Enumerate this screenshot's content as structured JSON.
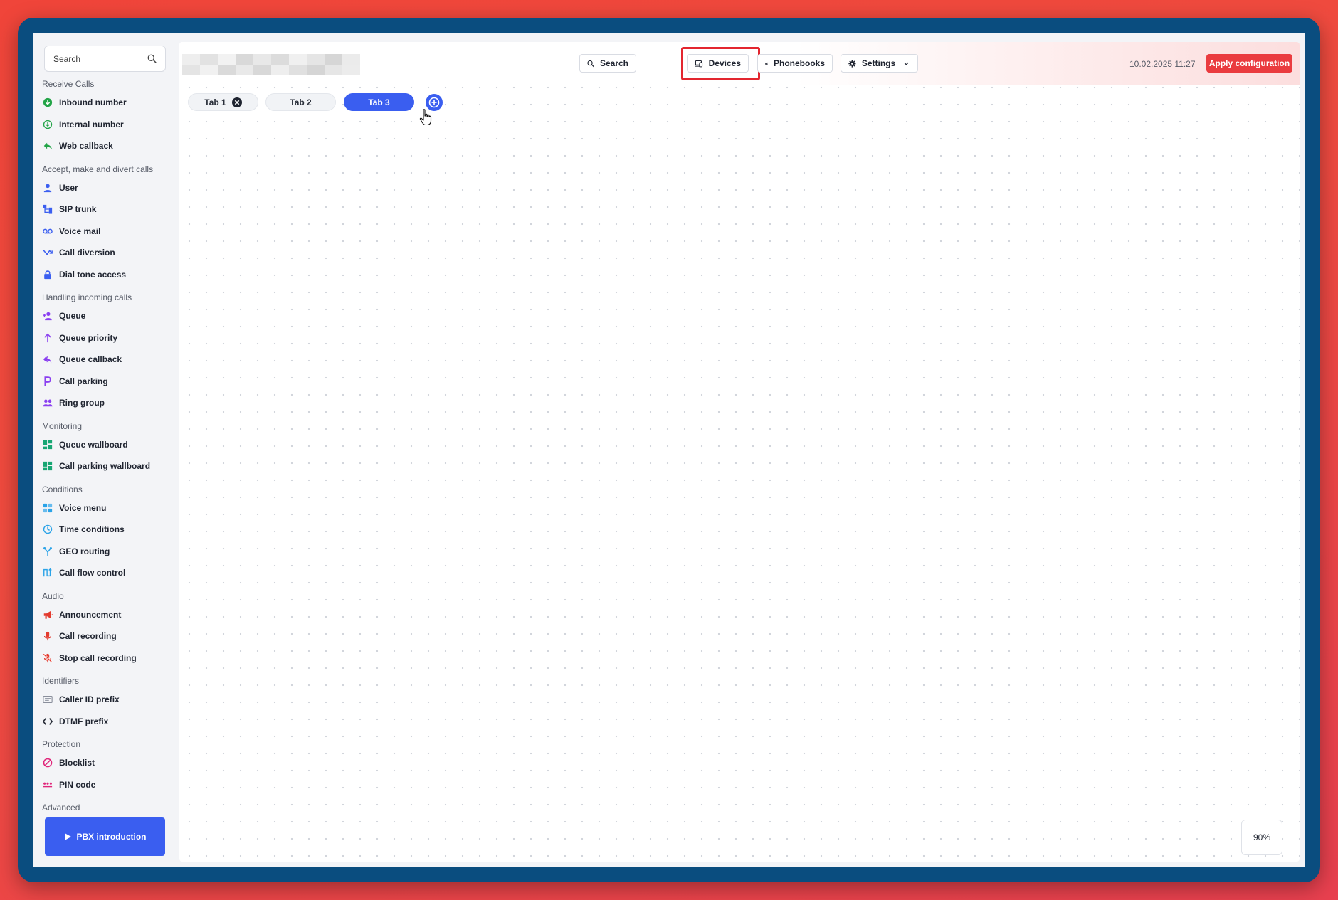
{
  "sidebar": {
    "search_placeholder": "Search",
    "sections": [
      {
        "title": "Receive Calls",
        "items": [
          {
            "label": "Inbound number",
            "icon": "inbound-number-icon",
            "color": "#22a447"
          },
          {
            "label": "Internal number",
            "icon": "internal-number-icon",
            "color": "#22a447"
          },
          {
            "label": "Web callback",
            "icon": "web-callback-icon",
            "color": "#22a447"
          }
        ]
      },
      {
        "title": "Accept, make and divert calls",
        "items": [
          {
            "label": "User",
            "icon": "user-icon",
            "color": "#3a5ef0"
          },
          {
            "label": "SIP trunk",
            "icon": "sip-trunk-icon",
            "color": "#3a5ef0"
          },
          {
            "label": "Voice mail",
            "icon": "voicemail-icon",
            "color": "#3a5ef0"
          },
          {
            "label": "Call diversion",
            "icon": "call-diversion-icon",
            "color": "#3a5ef0"
          },
          {
            "label": "Dial tone access",
            "icon": "lock-icon",
            "color": "#3a5ef0"
          }
        ]
      },
      {
        "title": "Handling incoming calls",
        "items": [
          {
            "label": "Queue",
            "icon": "queue-icon",
            "color": "#8a3ff0"
          },
          {
            "label": "Queue priority",
            "icon": "arrow-up-icon",
            "color": "#8a3ff0"
          },
          {
            "label": "Queue callback",
            "icon": "queue-callback-icon",
            "color": "#8a3ff0"
          },
          {
            "label": "Call parking",
            "icon": "parking-icon",
            "color": "#8a3ff0"
          },
          {
            "label": "Ring group",
            "icon": "ring-group-icon",
            "color": "#8a3ff0"
          }
        ]
      },
      {
        "title": "Monitoring",
        "items": [
          {
            "label": "Queue wallboard",
            "icon": "dashboard-icon",
            "color": "#17a673"
          },
          {
            "label": "Call parking wallboard",
            "icon": "dashboard-icon",
            "color": "#17a673"
          }
        ]
      },
      {
        "title": "Conditions",
        "items": [
          {
            "label": "Voice menu",
            "icon": "grid-icon",
            "color": "#2aa3e8"
          },
          {
            "label": "Time conditions",
            "icon": "clock-icon",
            "color": "#2aa3e8"
          },
          {
            "label": "GEO routing",
            "icon": "fork-icon",
            "color": "#2aa3e8"
          },
          {
            "label": "Call flow control",
            "icon": "flow-icon",
            "color": "#2aa3e8"
          }
        ]
      },
      {
        "title": "Audio",
        "items": [
          {
            "label": "Announcement",
            "icon": "megaphone-icon",
            "color": "#e33b2f"
          },
          {
            "label": "Call recording",
            "icon": "microphone-icon",
            "color": "#e33b2f"
          },
          {
            "label": "Stop call recording",
            "icon": "microphone-off-icon",
            "color": "#e33b2f"
          }
        ]
      },
      {
        "title": "Identifiers",
        "items": [
          {
            "label": "Caller ID prefix",
            "icon": "caller-id-icon",
            "color": "#8a8f9c"
          },
          {
            "label": "DTMF prefix",
            "icon": "code-icon",
            "color": "#2a2f3a"
          }
        ]
      },
      {
        "title": "Protection",
        "items": [
          {
            "label": "Blocklist",
            "icon": "block-icon",
            "color": "#e0267a"
          },
          {
            "label": "PIN code",
            "icon": "pin-icon",
            "color": "#e0267a"
          }
        ]
      },
      {
        "title": "Advanced",
        "items": []
      }
    ],
    "intro_button": "PBX introduction"
  },
  "topbar": {
    "search_label": "Search",
    "devices_label": "Devices",
    "phonebooks_label": "Phonebooks",
    "settings_label": "Settings",
    "datetime": "10.02.2025 11:27",
    "apply_label": "Apply configuration"
  },
  "tabs": [
    {
      "label": "Tab 1",
      "state": "inactive",
      "closable": true
    },
    {
      "label": "Tab 2",
      "state": "inactive",
      "closable": false
    },
    {
      "label": "Tab 3",
      "state": "active",
      "closable": false
    }
  ],
  "zoom": "90%",
  "colors": {
    "accent": "#3a5ef0",
    "danger": "#ea3b3f",
    "highlight": "#e3262f"
  }
}
